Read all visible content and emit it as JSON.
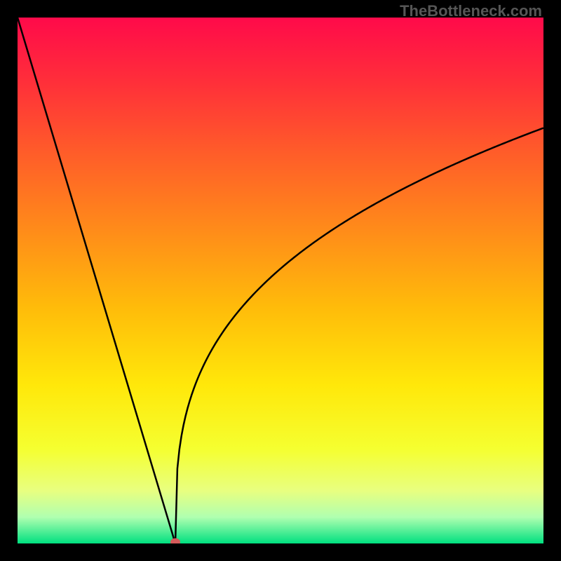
{
  "watermark": "TheBottleneck.com",
  "chart_data": {
    "type": "line",
    "title": "",
    "xlabel": "",
    "ylabel": "",
    "xlim": [
      0,
      100
    ],
    "ylim": [
      0,
      100
    ],
    "curve": {
      "description": "V-shaped curve, linear decline on left, sqrt-like asymptotic rise on right",
      "minimum_x": 30,
      "minimum_y": 0,
      "left_branch_start": {
        "x": 0,
        "y": 100
      },
      "right_branch_end": {
        "x": 100,
        "y": 79
      }
    },
    "marker": {
      "x": 30,
      "y": 0,
      "color": "#d55a5a"
    },
    "background_gradient": {
      "type": "vertical",
      "stops": [
        {
          "pos": 0.0,
          "color": "#ff0a4a"
        },
        {
          "pos": 0.12,
          "color": "#ff2e3a"
        },
        {
          "pos": 0.25,
          "color": "#ff5a2a"
        },
        {
          "pos": 0.4,
          "color": "#ff8a1a"
        },
        {
          "pos": 0.55,
          "color": "#ffbb0a"
        },
        {
          "pos": 0.7,
          "color": "#ffe80a"
        },
        {
          "pos": 0.82,
          "color": "#f5ff30"
        },
        {
          "pos": 0.9,
          "color": "#e8ff80"
        },
        {
          "pos": 0.95,
          "color": "#b0ffb0"
        },
        {
          "pos": 1.0,
          "color": "#00e080"
        }
      ]
    }
  }
}
